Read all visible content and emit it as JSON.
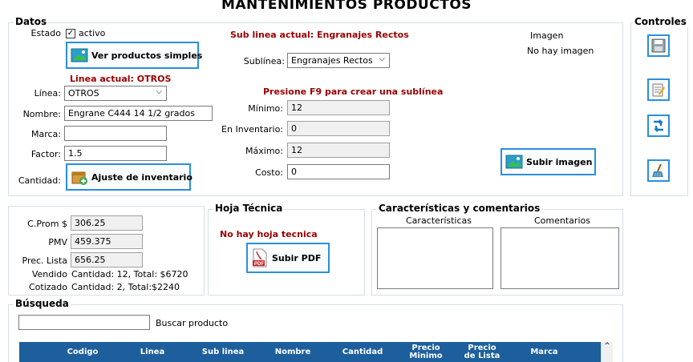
{
  "window_title": "MANTENIMIENTOS PRODUCTOS",
  "datos": {
    "legend": "Datos",
    "estado_label": "Estado",
    "activo_label": "activo",
    "activo_checked": true,
    "ver_productos_label": "Ver productos simples",
    "linea_actual": "Linea actual: OTROS",
    "linea_label": "Línea:",
    "linea_value": "OTROS",
    "nombre_label": "Nombre:",
    "nombre_value": "Engrane C444  14 1/2 grados",
    "marca_label": "Marca:",
    "marca_value": "",
    "factor_label": "Factor:",
    "factor_value": "1.5",
    "cantidad_label": "Cantidad:",
    "ajuste_label": "Ajuste de inventario",
    "sublinea_actual": "Sub linea actual: Engranajes Rectos",
    "sublinea_label": "Sublínea:",
    "sublinea_value": "Engranajes Rectos",
    "f9_hint": "Presione F9 para crear una sublínea",
    "minimo_label": "Mínimo:",
    "minimo_value": "12",
    "inventario_label": "En Inventario:",
    "inventario_value": "0",
    "maximo_label": "Máximo:",
    "maximo_value": "12",
    "costo_label": "Costo:",
    "costo_value": "0",
    "imagen_label": "Imagen",
    "no_imagen": "No hay imagen",
    "subir_imagen_label": "Subir imagen"
  },
  "precios": {
    "cprom_label": "C.Prom $",
    "cprom_value": "306.25",
    "pmv_label": "PMV",
    "pmv_value": "459.375",
    "prec_lista_label": "Prec. Lista",
    "prec_lista_value": "656.25",
    "vendido_label": "Vendido",
    "vendido_value": "Cantidad: 12, Total: $6720",
    "cotizado_label": "Cotizado",
    "cotizado_value": "Cantidad: 2, Total:$2240"
  },
  "hoja_tecnica": {
    "legend": "Hoja Técnica",
    "no_hoja": "No hay hoja tecnica",
    "subir_pdf_label": "Subir PDF"
  },
  "caracteristicas": {
    "legend": "Características y comentarios",
    "caracteristicas_label": "Características",
    "comentarios_label": "Comentarios"
  },
  "controles": {
    "legend": "Controles",
    "buttons": [
      "save-icon",
      "edit-icon",
      "refresh-icon",
      "clean-icon"
    ]
  },
  "busqueda": {
    "legend": "Búsqueda",
    "search_value": "",
    "buscar_label": "Buscar producto",
    "columns": [
      "Codigo",
      "Linea",
      "Sub linea",
      "Nombre",
      "Cantidad",
      "Precio Minimo",
      "Precio de Lista",
      "Marca"
    ]
  },
  "colors": {
    "accent_border": "#2a8fdb",
    "dark_red": "#990000",
    "grid_header": "#1d5f9c"
  }
}
